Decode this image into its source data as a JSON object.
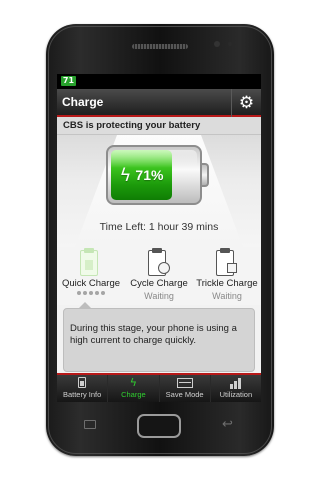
{
  "status_bar": {
    "notification_icon_text": "71"
  },
  "header": {
    "title": "Charge",
    "settings_icon": "gear-icon"
  },
  "banner": {
    "text": "CBS is protecting your battery"
  },
  "battery": {
    "percent_label": "71%",
    "level": 0.71,
    "icon": "bolt-icon",
    "fill_color": "#3cc41e"
  },
  "time_left": "Time Left: 1 hour 39 mins",
  "stages": [
    {
      "name": "Quick Charge",
      "status": "",
      "active": true,
      "progress_dots": 5,
      "icon": "clipboard-icon"
    },
    {
      "name": "Cycle Charge",
      "status": "Waiting",
      "active": false,
      "icon": "cycle-clipboard-icon"
    },
    {
      "name": "Trickle Charge",
      "status": "Waiting",
      "active": false,
      "icon": "trickle-clipboard-icon"
    }
  ],
  "description": "During this stage, your phone is using a high current to charge quickly.",
  "nav": [
    {
      "label": "Battery Info",
      "icon": "battery-icon",
      "active": false
    },
    {
      "label": "Charge",
      "icon": "bolt-icon",
      "active": true
    },
    {
      "label": "Save Mode",
      "icon": "save-mode-icon",
      "active": false
    },
    {
      "label": "Utilization",
      "icon": "bar-chart-icon",
      "active": false
    }
  ],
  "colors": {
    "accent_red": "#b81919",
    "active_green": "#2fcf2f",
    "status_icon_green": "#27a12c"
  }
}
